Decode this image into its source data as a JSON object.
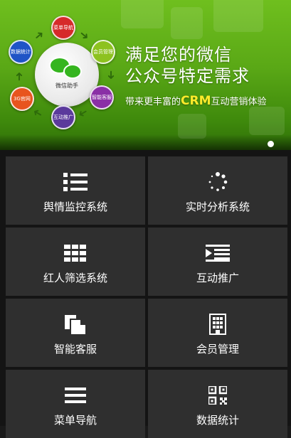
{
  "banner": {
    "hub_label": "微信助手",
    "nodes": [
      {
        "label": "菜单导航",
        "color": "#d62a2a"
      },
      {
        "label": "会员管理",
        "color": "#8dc21f"
      },
      {
        "label": "智能客服",
        "color": "#8a2fa6"
      },
      {
        "label": "互动推广",
        "color": "#5b3a9c"
      },
      {
        "label": "3G官网",
        "color": "#e8541e"
      },
      {
        "label": "数据统计",
        "color": "#1f54c6"
      }
    ],
    "headline_line1": "满足您的微信",
    "headline_line2": "公众号特定需求",
    "tagline_prefix": "带来更丰富的",
    "tagline_highlight": "CRM",
    "tagline_suffix": "互动营销体验",
    "active_slide": 1
  },
  "menu": [
    {
      "label": "舆情监控系统",
      "icon": "list-icon"
    },
    {
      "label": "实时分析系统",
      "icon": "loading-icon"
    },
    {
      "label": "红人筛选系统",
      "icon": "grid-icon"
    },
    {
      "label": "互动推广",
      "icon": "presentation-icon"
    },
    {
      "label": "智能客服",
      "icon": "document-icon"
    },
    {
      "label": "会员管理",
      "icon": "building-icon"
    },
    {
      "label": "菜单导航",
      "icon": "hamburger-icon"
    },
    {
      "label": "数据统计",
      "icon": "qrcode-icon"
    }
  ]
}
